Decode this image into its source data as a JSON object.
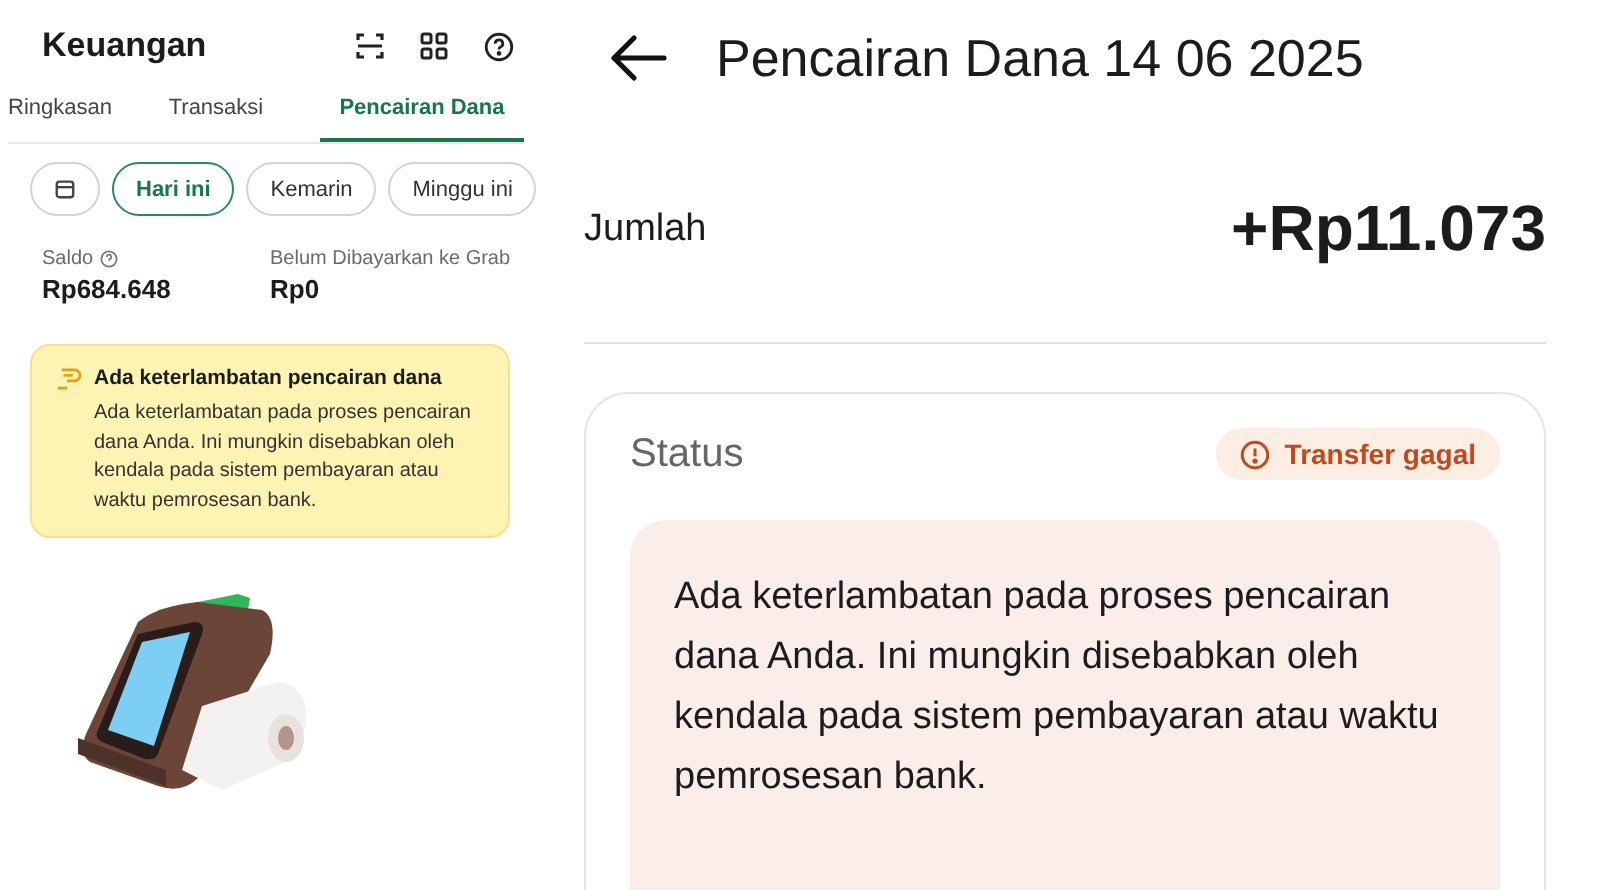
{
  "left_panel": {
    "title": "Keuangan",
    "tabs": [
      {
        "label": "Ringkasan",
        "selected": false
      },
      {
        "label": "Transaksi",
        "selected": false
      },
      {
        "label": "Pencairan Dana",
        "selected": true
      }
    ],
    "date_filters": [
      {
        "kind": "calendar",
        "selected": false
      },
      {
        "kind": "text",
        "label": "Hari ini",
        "selected": true
      },
      {
        "kind": "text",
        "label": "Kemarin",
        "selected": false
      },
      {
        "kind": "text",
        "label": "Minggu ini",
        "selected": false
      }
    ],
    "balances": [
      {
        "label": "Saldo",
        "help": true,
        "value": "Rp684.648"
      },
      {
        "label": "Belum Dibayarkan ke Grab",
        "help": false,
        "value": "Rp0"
      }
    ],
    "alert": {
      "title": "Ada keterlambatan pencairan dana",
      "message": "Ada keterlambatan pada proses pencairan dana Anda. Ini mungkin disebabkan oleh kendala pada sistem pembayaran atau waktu pemrosesan bank."
    }
  },
  "detail_panel": {
    "title": "Pencairan Dana 14 06 2025",
    "amount_label": "Jumlah",
    "amount": "+Rp11.073",
    "status_label": "Status",
    "status": "Transfer gagal",
    "message": "Ada keterlambatan pada proses pencairan dana Anda. Ini mungkin disebabkan oleh kendala pada sistem pembayaran atau waktu pemrosesan bank."
  }
}
